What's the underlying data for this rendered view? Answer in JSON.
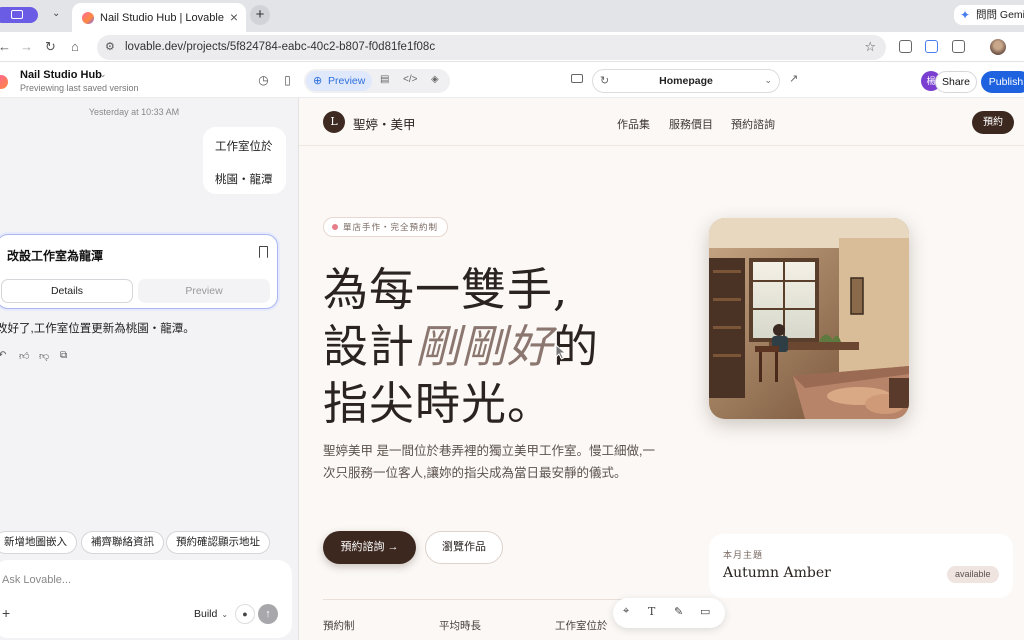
{
  "browser": {
    "tab_title": "Nail Studio Hub | Lovable",
    "tab_close": "×",
    "new_tab": "+",
    "gemini_label": "問問 Gemini",
    "url": "lovable.dev/projects/5f824784-eabc-40c2-b807-f0d81fe1f08c"
  },
  "app": {
    "project_name": "Nail Studio Hub",
    "project_status": "Previewing last saved version",
    "preview_tab": "Preview",
    "page_select": "Homepage",
    "avatar_initial": "楊",
    "share": "Share",
    "publish": "Publish",
    "brand_color": "#1f62e0"
  },
  "chat": {
    "timestamp": "Yesterday at 10:33 AM",
    "user_message_line1": "工作室位於",
    "user_message_line2": "桃園・龍潭",
    "card_title": "改設工作室為龍潭",
    "details": "Details",
    "preview": "Preview",
    "reply": "改好了,工作室位置更新為桃園・龍潭。",
    "suggestions": [
      "新增地圖嵌入",
      "補齊聯絡資訊",
      "預約確認顯示地址"
    ],
    "input_placeholder": "Ask Lovable...",
    "build_label": "Build"
  },
  "site": {
    "logo_letter": "L",
    "brand": "聖婷・美甲",
    "nav": [
      "作品集",
      "服務價目",
      "預約諮詢"
    ],
    "nav_cta": "預約",
    "badge": "單店手作・完全預約制",
    "hero_line1": "為每一雙手,",
    "hero_line2_pre": "設計",
    "hero_line2_em": "剛剛好",
    "hero_line2_post": "的",
    "hero_line3": "指尖時光。",
    "description": "聖婷美甲 是一間位於巷弄裡的獨立美甲工作室。慢工細做,一次只服務一位客人,讓妳的指尖成為當日最安靜的儀式。",
    "cta_primary": "預約諮詢 →",
    "cta_secondary": "瀏覽作品",
    "stats": [
      "預約制",
      "平均時長",
      "工作室位於"
    ],
    "theme_label": "本月主題",
    "theme_name": "Autumn Amber",
    "theme_status": "available",
    "accent_color": "#3d2820"
  }
}
